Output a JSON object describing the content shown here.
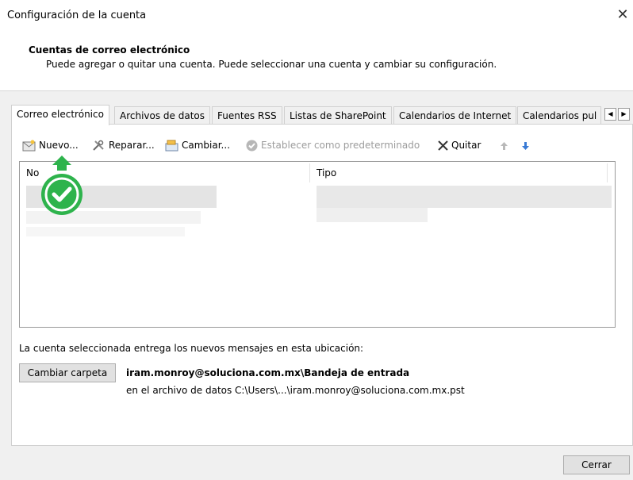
{
  "window": {
    "title": "Configuración de la cuenta",
    "close_glyph": "✕"
  },
  "header": {
    "title": "Cuentas de correo electrónico",
    "description": "Puede agregar o quitar una cuenta. Puede seleccionar una cuenta y cambiar su configuración."
  },
  "tabs": [
    {
      "label": "Correo electrónico",
      "active": true
    },
    {
      "label": "Archivos de datos"
    },
    {
      "label": "Fuentes RSS"
    },
    {
      "label": "Listas de SharePoint"
    },
    {
      "label": "Calendarios de Internet"
    },
    {
      "label": "Calendarios pul"
    }
  ],
  "toolbar": {
    "new": "Nuevo...",
    "repair": "Reparar...",
    "change": "Cambiar...",
    "set_default": "Establecer como predeterminado",
    "remove": "Quitar"
  },
  "list": {
    "columns": [
      "No",
      "Tipo"
    ]
  },
  "delivery": {
    "label": "La cuenta seleccionada entrega los nuevos mensajes en esta ubicación:",
    "button": "Cambiar carpeta",
    "location": "iram.monroy@soluciona.com.mx\\Bandeja de entrada",
    "file": "en el archivo de datos C:\\Users\\...\\iram.monroy@soluciona.com.mx.pst"
  },
  "footer": {
    "close": "Cerrar"
  },
  "colors": {
    "badge_green": "#2eb34c",
    "arrow_blue": "#3a7bd5"
  }
}
